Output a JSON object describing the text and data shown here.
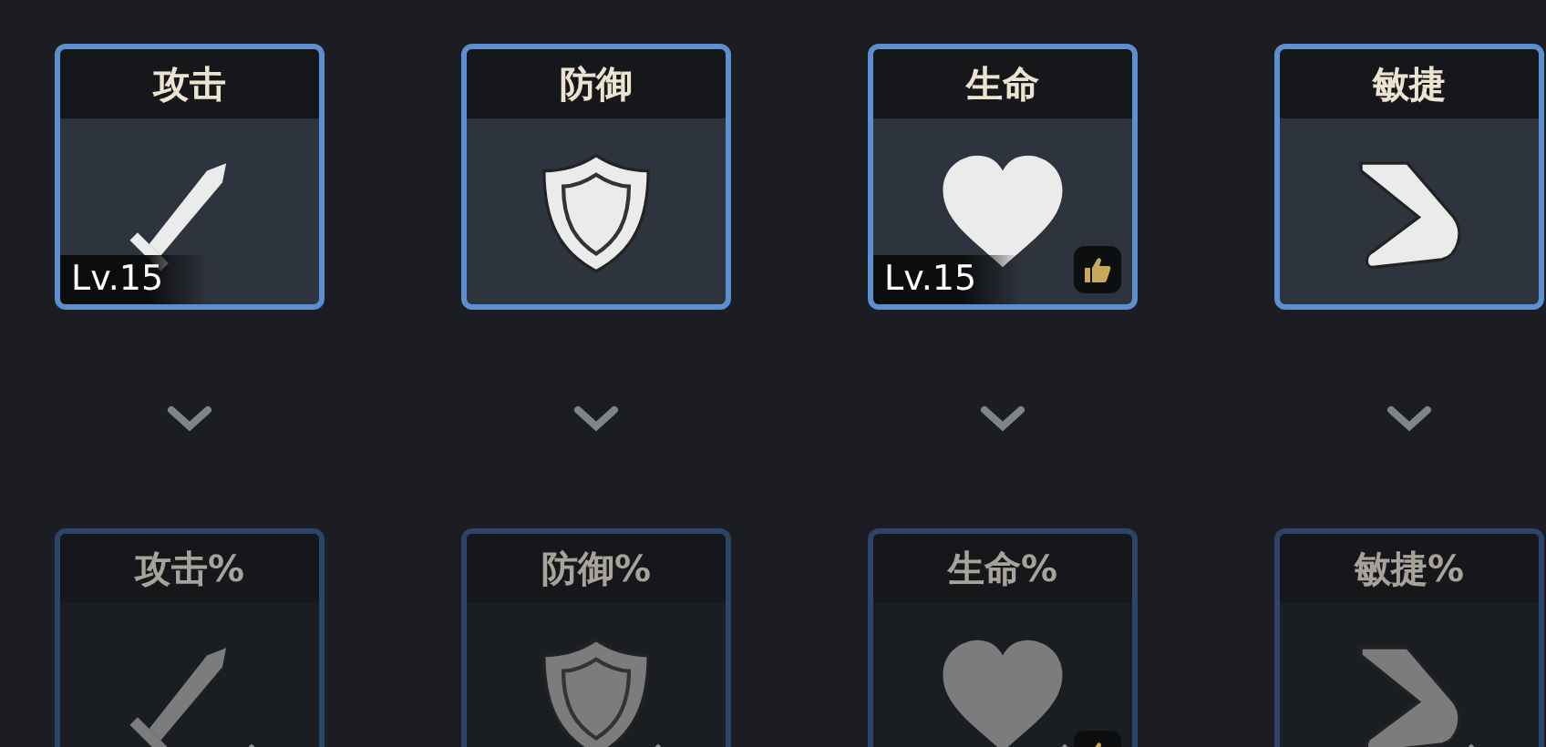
{
  "rows": [
    {
      "cards": [
        {
          "label": "攻击",
          "kind": "sword",
          "dimmed": false,
          "boost": false,
          "level_text": "Lv.15",
          "liked": false
        },
        {
          "label": "防御",
          "kind": "shield",
          "dimmed": false,
          "boost": false,
          "liked": false
        },
        {
          "label": "生命",
          "kind": "heart",
          "dimmed": false,
          "boost": false,
          "level_text": "Lv.15",
          "liked": true
        },
        {
          "label": "敏捷",
          "kind": "boot",
          "dimmed": false,
          "boost": false,
          "liked": false
        }
      ]
    },
    {
      "cards": [
        {
          "label": "攻击%",
          "kind": "sword",
          "dimmed": true,
          "boost": true,
          "liked": false
        },
        {
          "label": "防御%",
          "kind": "shield",
          "dimmed": true,
          "boost": true,
          "liked": false
        },
        {
          "label": "生命%",
          "kind": "heart",
          "dimmed": true,
          "boost": true,
          "liked": true
        },
        {
          "label": "敏捷%",
          "kind": "boot",
          "dimmed": true,
          "boost": true,
          "liked": false
        }
      ]
    }
  ]
}
